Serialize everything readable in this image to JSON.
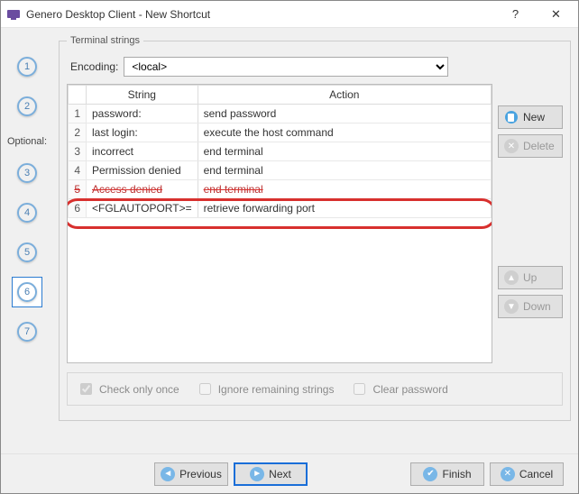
{
  "window": {
    "title": "Genero Desktop Client - New Shortcut",
    "help_btn": "?",
    "close_btn": "✕"
  },
  "sidebar": {
    "optional_label": "Optional:",
    "steps": [
      "1",
      "2",
      "3",
      "4",
      "5",
      "6",
      "7"
    ],
    "current": 6
  },
  "panel": {
    "legend": "Terminal strings",
    "encoding_label": "Encoding:",
    "encoding_value": "<local>",
    "columns": {
      "string": "String",
      "action": "Action"
    },
    "rows": [
      {
        "n": "1",
        "string": "password:",
        "action": "send password"
      },
      {
        "n": "2",
        "string": "last login:",
        "action": "execute the host command"
      },
      {
        "n": "3",
        "string": "incorrect",
        "action": "end terminal"
      },
      {
        "n": "4",
        "string": "Permission denied",
        "action": "end terminal"
      },
      {
        "n": "5",
        "string": "Access denied",
        "action": "end terminal"
      },
      {
        "n": "6",
        "string": "<FGLAUTOPORT>=",
        "action": "retrieve forwarding port"
      }
    ],
    "side_buttons": {
      "new": "New",
      "delete": "Delete",
      "up": "Up",
      "down": "Down"
    },
    "checks": {
      "check_only_once": "Check only once",
      "ignore_remaining": "Ignore remaining strings",
      "clear_password": "Clear password"
    }
  },
  "nav": {
    "previous": "Previous",
    "next": "Next",
    "finish": "Finish",
    "cancel": "Cancel"
  }
}
